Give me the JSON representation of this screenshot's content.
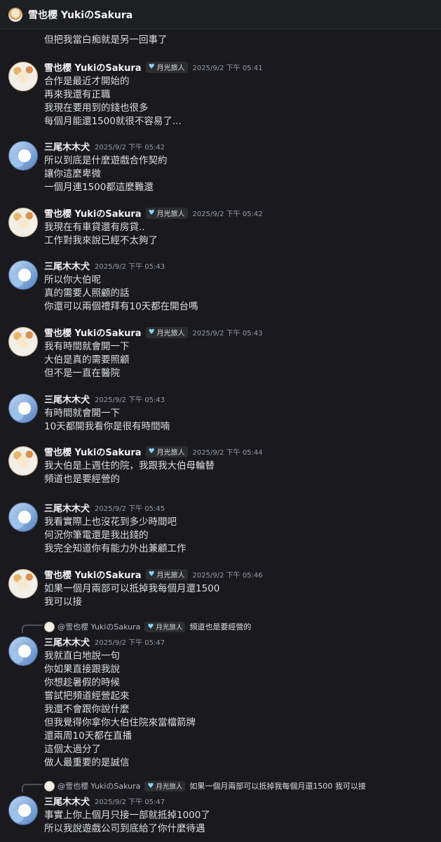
{
  "window": {
    "title": "雪也櫻 YukiのSakura"
  },
  "badge_label": "月光旅人",
  "continuation": {
    "text": "但把我當白痴就是另一回事了"
  },
  "messages": [
    {
      "author": "雪也櫻 YukiのSakura",
      "badge": true,
      "time": "2025/9/2 下午 05:41",
      "lines": [
        "合作是最近才開始的",
        "再來我還有正職",
        "我現在要用到的錢也很多",
        "每個月能還1500就很不容易了..."
      ]
    },
    {
      "author": "三尾木木犬",
      "badge": false,
      "time": "2025/9/2 下午 05:42",
      "lines": [
        "所以到底是什麼遊戲合作契約",
        "讓你這麼卑微",
        "一個月連1500都這麼難還"
      ]
    },
    {
      "author": "雪也櫻 YukiのSakura",
      "badge": true,
      "time": "2025/9/2 下午 05:42",
      "lines": [
        "我現在有車貸還有房貸..",
        "工作對我來說已經不太夠了"
      ]
    },
    {
      "author": "三尾木木犬",
      "badge": false,
      "time": "2025/9/2 下午 05:43",
      "lines": [
        "所以你大伯呢",
        "真的需要人照顧的話",
        "你還可以兩個禮拜有10天都在開台嗎"
      ]
    },
    {
      "author": "雪也櫻 YukiのSakura",
      "badge": true,
      "time": "2025/9/2 下午 05:43",
      "lines": [
        "我有時間就會開一下",
        "大伯是真的需要照顧",
        "但不是一直在醫院"
      ]
    },
    {
      "author": "三尾木木犬",
      "badge": false,
      "time": "2025/9/2 下午 05:43",
      "lines": [
        "有時間就會開一下",
        "10天都開我看你是很有時間喃"
      ]
    },
    {
      "author": "雪也櫻 YukiのSakura",
      "badge": true,
      "time": "2025/9/2 下午 05:44",
      "lines": [
        "我大伯是上週住的院，我跟我大伯母輪替",
        "頻道也是要經營的"
      ]
    },
    {
      "author": "三尾木木犬",
      "badge": false,
      "time": "2025/9/2 下午 05:45",
      "lines": [
        "我看實際上也沒花到多少時間吧",
        "何況你筆電還是我出錢的",
        "我完全知道你有能力外出兼顧工作"
      ]
    },
    {
      "author": "雪也櫻 YukiのSakura",
      "badge": true,
      "time": "2025/9/2 下午 05:46",
      "lines": [
        "如果一個月兩部可以抵掉我每個月還1500",
        "我可以接"
      ]
    },
    {
      "author": "三尾木木犬",
      "badge": false,
      "time": "2025/9/2 下午 05:47",
      "reply": {
        "author": "@雪也櫻 YukiのSakura",
        "text": "頻道也是要經營的"
      },
      "lines": [
        "我就直白地說一句",
        "你如果直接跟我說",
        "你想趁暑假的時候",
        "嘗試把頻道經營起來",
        "我還不會跟你說什麼",
        "但我覺得你拿你大伯住院來當檔箭牌",
        "還兩周10天都在直播",
        "這個太過分了",
        "做人最重要的是誠信"
      ]
    },
    {
      "author": "三尾木木犬",
      "badge": false,
      "time": "2025/9/2 下午 05:47",
      "reply": {
        "author": "@雪也櫻 YukiのSakura",
        "text": "如果一個月兩部可以抵掉我每個月還1500 我可以接"
      },
      "lines": [
        "事實上你上個月只接一部就抵掉1000了",
        "所以我說遊戲公司到底給了你什麼待遇"
      ]
    }
  ]
}
